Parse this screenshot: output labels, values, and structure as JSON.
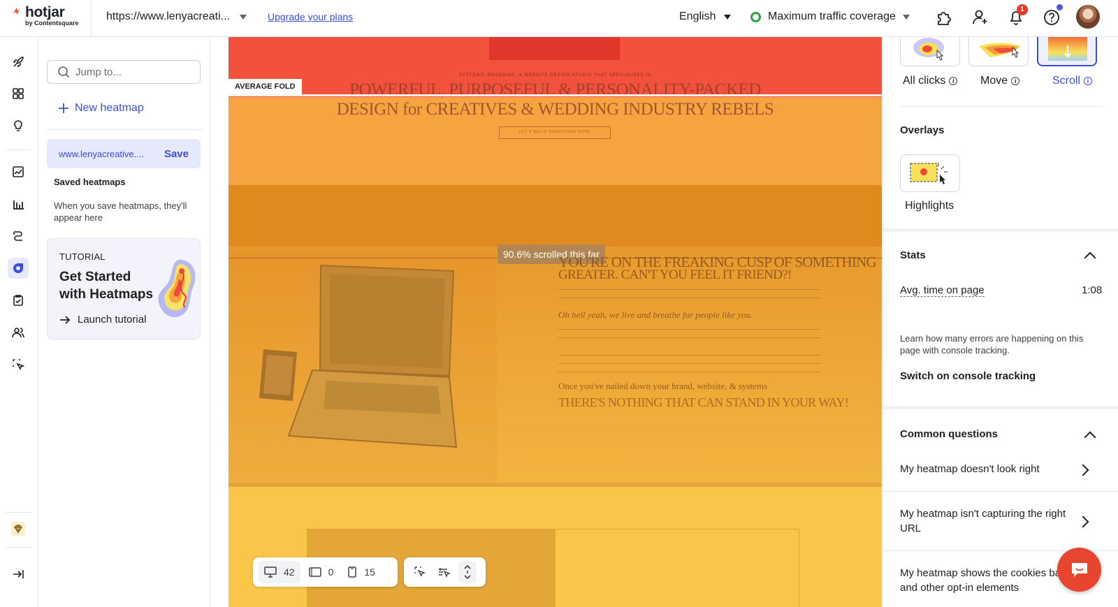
{
  "topbar": {
    "logo_text": "hotjar",
    "logo_sub": "by Contentsquare",
    "url": "https://www.lenyacreati...",
    "upgrade": "Upgrade your plans",
    "language": "English",
    "coverage": "Maximum traffic coverage",
    "notifications_count": "1",
    "icons": [
      "puzzle-icon",
      "add-user-icon",
      "bell-icon",
      "help-icon",
      "avatar"
    ]
  },
  "leftnav": {
    "items": [
      "rocket-icon",
      "dashboard-icon",
      "lightbulb-icon",
      "trends-icon",
      "bar-chart-icon",
      "funnel-icon",
      "heatmaps-icon",
      "surveys-icon",
      "users-icon",
      "recordings-icon",
      "diamond-icon",
      "collapse-icon"
    ],
    "active": "heatmaps-icon"
  },
  "panel": {
    "search_placeholder": "Jump to...",
    "new_heatmap": "New heatmap",
    "current_url": "www.lenyacreative....",
    "save": "Save",
    "saved_title": "Saved heatmaps",
    "saved_empty": "When you save heatmaps, they'll appear here",
    "tutorial": {
      "label": "TUTORIAL",
      "title": "Get Started with Heatmaps",
      "launch": "Launch tutorial"
    }
  },
  "canvas": {
    "fold_label": "AVERAGE FOLD",
    "site_tagline": "SYSTEMS, BRANDING, & WEBSITE DESIGN STUDIO THAT SPECIALIZES IN",
    "site_headline_1": "POWERFUL, PURPOSEFUL & PERSONALITY-PACKED",
    "site_headline_2": "DESIGN for CREATIVES & WEDDING INDUSTRY REBELS",
    "site_cta": "LET'S BUILD SOMETHING DOPE",
    "section_headline_1": "YOU'RE ON THE FREAKING CUSP OF SOMETHING",
    "section_headline_2": "GREATER. CAN'T YOU FEEL IT FRIEND?!",
    "section_line_3": "Oh hell yeah, we live and breathe for people like you.",
    "section_line_4": "Once you've nailed down your brand, website, & systems",
    "section_line_5": "THERE'S NOTHING THAT CAN STAND IN YOUR WAY!",
    "scroll_label": "90.6% scrolled this far",
    "scroll_percent": 90.6
  },
  "toolbar": {
    "desktop_count": "42",
    "tablet_count": "0",
    "mobile_count": "15"
  },
  "rpanel": {
    "modes": [
      {
        "label": "All clicks"
      },
      {
        "label": "Move"
      },
      {
        "label": "Scroll",
        "selected": true
      }
    ],
    "overlays_title": "Overlays",
    "highlights": "Highlights",
    "stats_title": "Stats",
    "avg_time_label": "Avg. time on page",
    "avg_time_value": "1:08",
    "console_info": "Learn how many errors are happening on this page with console tracking.",
    "console_link": "Switch on console tracking",
    "faq_title": "Common questions",
    "faq": [
      "My heatmap doesn't look right",
      "My heatmap isn't capturing the right URL",
      "My heatmap shows the cookies banner and other opt-in elements"
    ]
  },
  "colors": {
    "accent": "#3c4ddb",
    "heat_red": "#f2523c",
    "heat_orange": "#f5a441",
    "heat_yellow": "#f9c64a",
    "chat": "#e8452f"
  }
}
